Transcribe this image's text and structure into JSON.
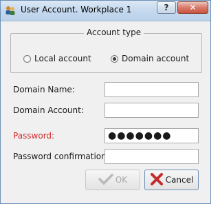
{
  "window": {
    "title": "User Account. Workplace 1",
    "help_glyph": "?",
    "close_glyph": "✕"
  },
  "account_type": {
    "title": "Account type",
    "options": [
      {
        "label": "Local account",
        "selected": false
      },
      {
        "label": "Domain account",
        "selected": true
      }
    ]
  },
  "form": {
    "domain_name": {
      "label": "Domain Name:",
      "value": ""
    },
    "domain_account": {
      "label": "Domain Account:",
      "value": ""
    },
    "password": {
      "label": "Password:",
      "value": "●●●●●●●",
      "error": true
    },
    "password_confirmation": {
      "label": "Password confirmation:",
      "value": ""
    }
  },
  "buttons": {
    "ok": {
      "label": "OK",
      "enabled": false
    },
    "cancel": {
      "label": "Cancel",
      "enabled": true
    }
  },
  "colors": {
    "error_label": "#d42a2a",
    "cancel_icon": "#c42b2b",
    "ok_icon_disabled": "#b9b9b9"
  },
  "icons": {
    "app": "users-icon",
    "ok": "check-arrow-icon",
    "cancel": "red-x-icon"
  }
}
